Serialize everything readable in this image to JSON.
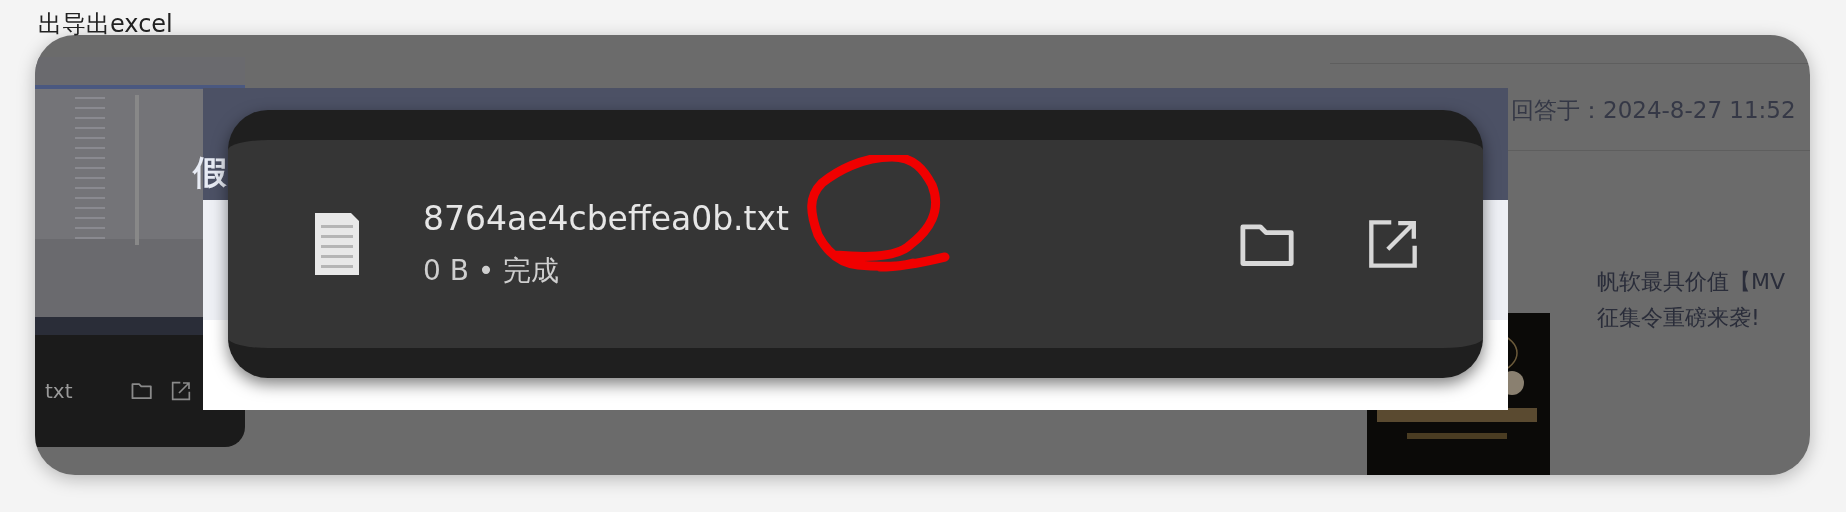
{
  "background_page": {
    "heading": "出导出excel",
    "answer_time": "回答于：2024-8-27 11:52",
    "promo_title": "帆软最具价值【MV",
    "promo_subtitle": "征集令重磅来袭!",
    "small_download": {
      "filename": "txt"
    }
  },
  "screenshot": {
    "partial_char": "假",
    "download": {
      "filename": "8764ae4cbeffea0b.txt",
      "status": "0 B • 完成"
    }
  }
}
